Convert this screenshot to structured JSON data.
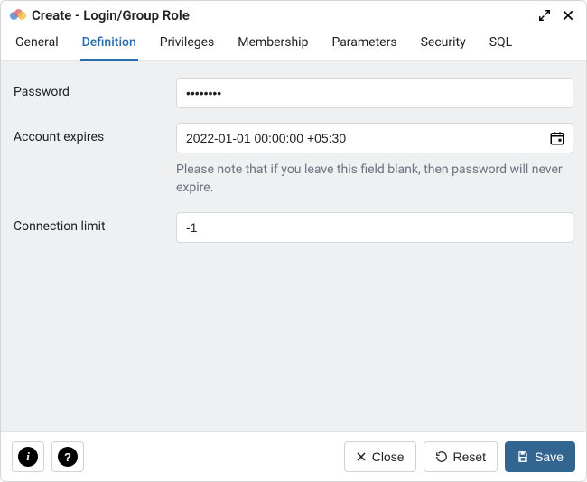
{
  "titlebar": {
    "title": "Create - Login/Group Role"
  },
  "tabs": [
    {
      "label": "General"
    },
    {
      "label": "Definition",
      "active": true
    },
    {
      "label": "Privileges"
    },
    {
      "label": "Membership"
    },
    {
      "label": "Parameters"
    },
    {
      "label": "Security"
    },
    {
      "label": "SQL"
    }
  ],
  "form": {
    "password": {
      "label": "Password",
      "value": "••••••••"
    },
    "account_expires": {
      "label": "Account expires",
      "value": "2022-01-01 00:00:00 +05:30",
      "helper": "Please note that if you leave this field blank, then password will never expire."
    },
    "connection_limit": {
      "label": "Connection limit",
      "value": "-1"
    }
  },
  "footer": {
    "close": "Close",
    "reset": "Reset",
    "save": "Save"
  },
  "icons": {
    "expand": "expand-icon",
    "close_x": "close-icon",
    "calendar": "calendar-icon",
    "info_i": "i",
    "help_q": "?",
    "save_disk": "save-icon"
  }
}
